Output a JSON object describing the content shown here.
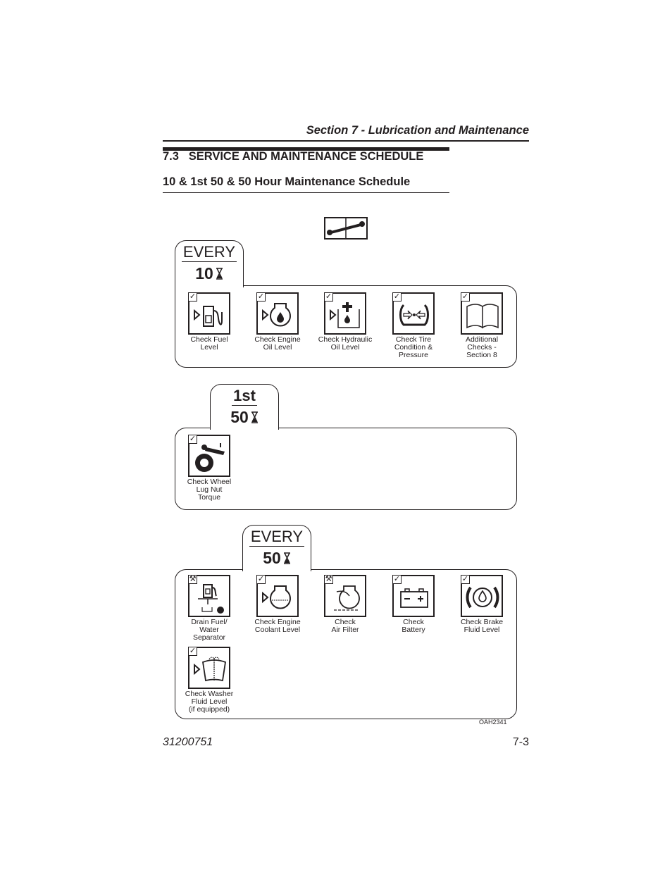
{
  "header": {
    "section": "Section 7 - Lubrication and Maintenance"
  },
  "heading": {
    "number_title": "7.3   SERVICE AND MAINTENANCE SCHEDULE",
    "subtitle": "10 & 1st 50 & 50 Hour Maintenance Schedule"
  },
  "intro_icon": "manual-wrench-icon",
  "schedules": [
    {
      "tab_top": "EVERY",
      "tab_hours": "10",
      "items": [
        {
          "label": "Check Fuel\nLevel",
          "mark": "check",
          "icon": "fuel-pump-icon"
        },
        {
          "label": "Check Engine\nOil Level",
          "mark": "check",
          "icon": "engine-oil-icon"
        },
        {
          "label": "Check Hydraulic\nOil Level",
          "mark": "check",
          "icon": "hydraulic-oil-icon"
        },
        {
          "label": "Check Tire\nCondition &\nPressure",
          "mark": "check",
          "icon": "tire-pressure-icon"
        },
        {
          "label": "Additional\nChecks -\nSection 8",
          "mark": "check",
          "icon": "book-icon"
        }
      ]
    },
    {
      "tab_top": "1st",
      "tab_hours": "50",
      "items": [
        {
          "label": "Check Wheel\nLug Nut\nTorque",
          "mark": "check",
          "icon": "wheel-torque-icon"
        }
      ]
    },
    {
      "tab_top": "EVERY",
      "tab_hours": "50",
      "items": [
        {
          "label": "Drain Fuel/\nWater\nSeparator",
          "mark": "wrench",
          "icon": "fuel-water-separator-icon"
        },
        {
          "label": "Check Engine\nCoolant Level",
          "mark": "check",
          "icon": "coolant-icon"
        },
        {
          "label": "Check\nAir Filter",
          "mark": "wrench",
          "icon": "air-filter-icon"
        },
        {
          "label": "Check\nBattery",
          "mark": "check",
          "icon": "battery-icon"
        },
        {
          "label": "Check Brake\nFluid Level",
          "mark": "check",
          "icon": "brake-fluid-icon"
        },
        {
          "label": "Check Washer\nFluid Level\n(if equipped)",
          "mark": "check",
          "icon": "washer-fluid-icon"
        }
      ]
    }
  ],
  "marks": {
    "check": "✓",
    "wrench": "⚒"
  },
  "figure_id": "OAH2341",
  "footer": {
    "doc_number": "31200751",
    "page": "7-3"
  }
}
